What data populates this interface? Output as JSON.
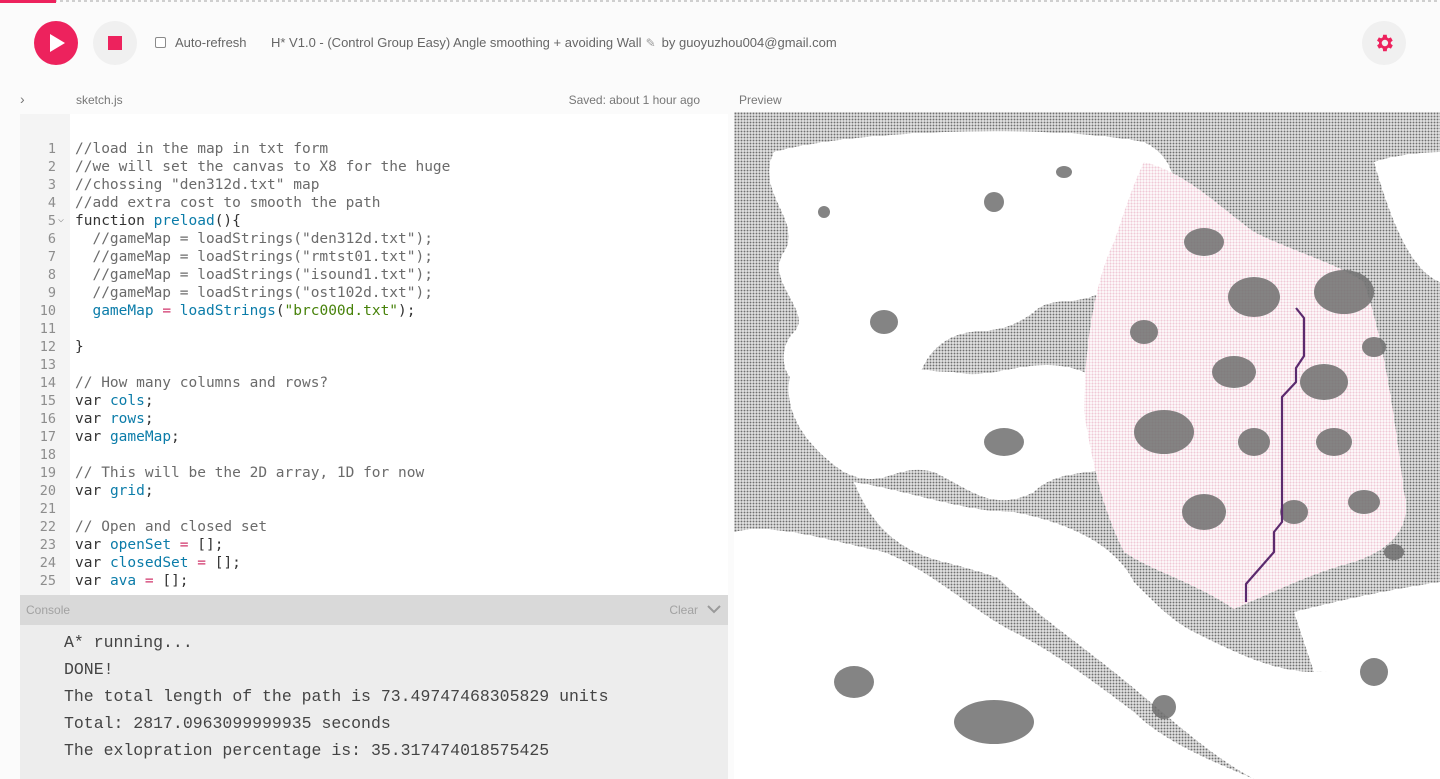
{
  "toolbar": {
    "play_icon": "play-icon",
    "stop_icon": "stop-icon",
    "auto_refresh_label": "Auto-refresh",
    "auto_refresh_checked": false,
    "project_title": "H* V1.0 - (Control Group Easy) Angle smoothing + avoiding Wall",
    "edit_icon": "pencil-icon",
    "byline": "by guoyuzhou004@gmail.com",
    "settings_icon": "gear-icon",
    "accent_color": "#ed225d"
  },
  "editor": {
    "file_name": "sketch.js",
    "saved_status": "Saved: about 1 hour ago",
    "lines": [
      {
        "n": "1",
        "text": "//load in the map in txt form"
      },
      {
        "n": "2",
        "text": "//we will set the canvas to X8 for the huge"
      },
      {
        "n": "3",
        "text": "//chossing \"den312d.txt\" map"
      },
      {
        "n": "4",
        "text": "//add extra cost to smooth the path"
      },
      {
        "n": "5",
        "text": "function preload(){"
      },
      {
        "n": "6",
        "text": "  //gameMap = loadStrings(\"den312d.txt\");"
      },
      {
        "n": "7",
        "text": "  //gameMap = loadStrings(\"rmtst01.txt\");"
      },
      {
        "n": "8",
        "text": "  //gameMap = loadStrings(\"isound1.txt\");"
      },
      {
        "n": "9",
        "text": "  //gameMap = loadStrings(\"ost102d.txt\");"
      },
      {
        "n": "10",
        "text": "  gameMap = loadStrings(\"brc000d.txt\");"
      },
      {
        "n": "11",
        "text": ""
      },
      {
        "n": "12",
        "text": "}"
      },
      {
        "n": "13",
        "text": ""
      },
      {
        "n": "14",
        "text": "// How many columns and rows?"
      },
      {
        "n": "15",
        "text": "var cols;"
      },
      {
        "n": "16",
        "text": "var rows;"
      },
      {
        "n": "17",
        "text": "var gameMap;"
      },
      {
        "n": "18",
        "text": ""
      },
      {
        "n": "19",
        "text": "// This will be the 2D array, 1D for now"
      },
      {
        "n": "20",
        "text": "var grid;"
      },
      {
        "n": "21",
        "text": ""
      },
      {
        "n": "22",
        "text": "// Open and closed set"
      },
      {
        "n": "23",
        "text": "var openSet = [];"
      },
      {
        "n": "24",
        "text": "var closedSet = [];"
      },
      {
        "n": "25",
        "text": "var ava = [];"
      }
    ]
  },
  "console": {
    "title": "Console",
    "clear_label": "Clear",
    "lines": [
      "A* running...",
      "DONE!",
      "The total length of the path is 73.49747468305829 units",
      "Total: 2817.0963099999935 seconds",
      "The exlopration percentage is: 35.317474018575425"
    ]
  },
  "preview": {
    "label": "Preview",
    "wall_color": "#6f6f6f",
    "explored_color": "#f4d6e0",
    "path_color": "#5b2a6e"
  }
}
